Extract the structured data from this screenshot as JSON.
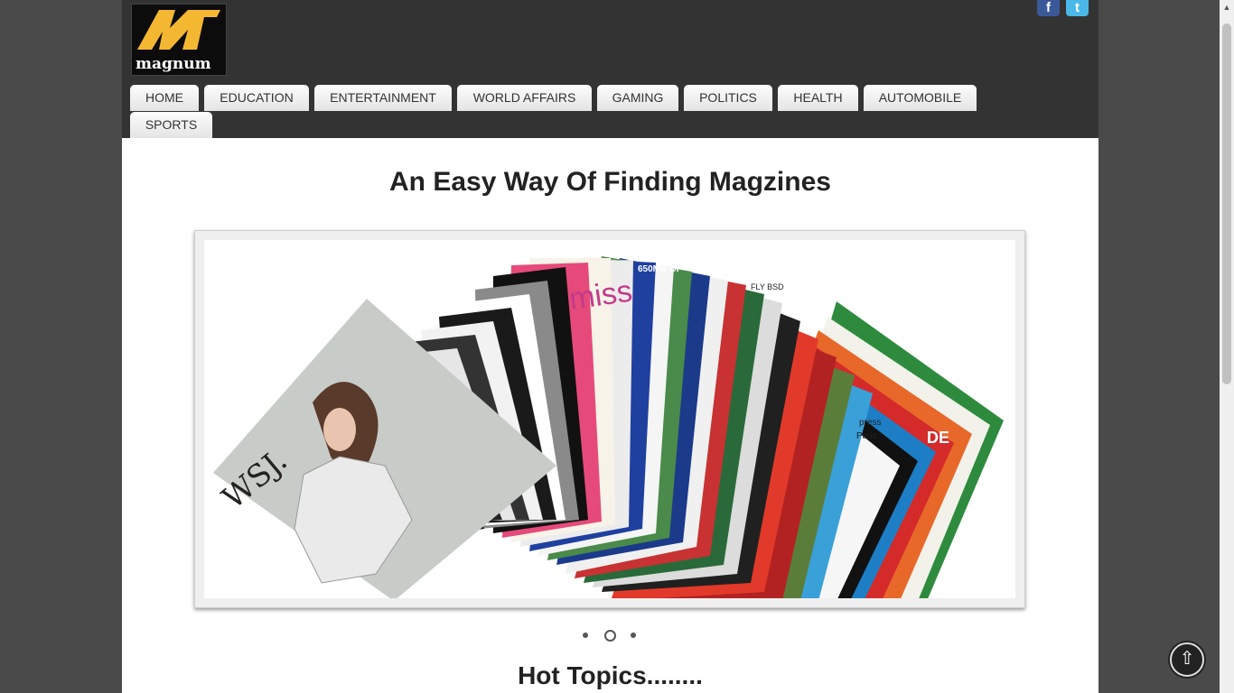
{
  "brand": {
    "logo_text": "magnum",
    "accent": "#f4b731"
  },
  "social": {
    "facebook_icon": "f",
    "twitter_icon": "t"
  },
  "nav": {
    "items": [
      {
        "label": "HOME"
      },
      {
        "label": "EDUCATION"
      },
      {
        "label": "ENTERTAINMENT"
      },
      {
        "label": "WORLD AFFAIRS"
      },
      {
        "label": "GAMING"
      },
      {
        "label": "POLITICS"
      },
      {
        "label": "HEALTH"
      },
      {
        "label": "AUTOMOBILE"
      },
      {
        "label": "SPORTS"
      }
    ]
  },
  "main": {
    "title": "An Easy Way Of Finding Magzines",
    "hot_topics": "Hot Topics........"
  },
  "slider": {
    "slide_count": 3,
    "active_index": 1,
    "cover_texts": [
      "WSJ.",
      "miss",
      "650MB OF",
      "FLY BSD",
      "press",
      "Paris",
      "DE"
    ]
  },
  "colors": {
    "header_bg": "#333333",
    "outer_bg": "#4a4a4a",
    "facebook": "#3b5998",
    "twitter": "#4ab8e8"
  },
  "icons": {
    "scroll_top": "up-arrow-icon"
  }
}
